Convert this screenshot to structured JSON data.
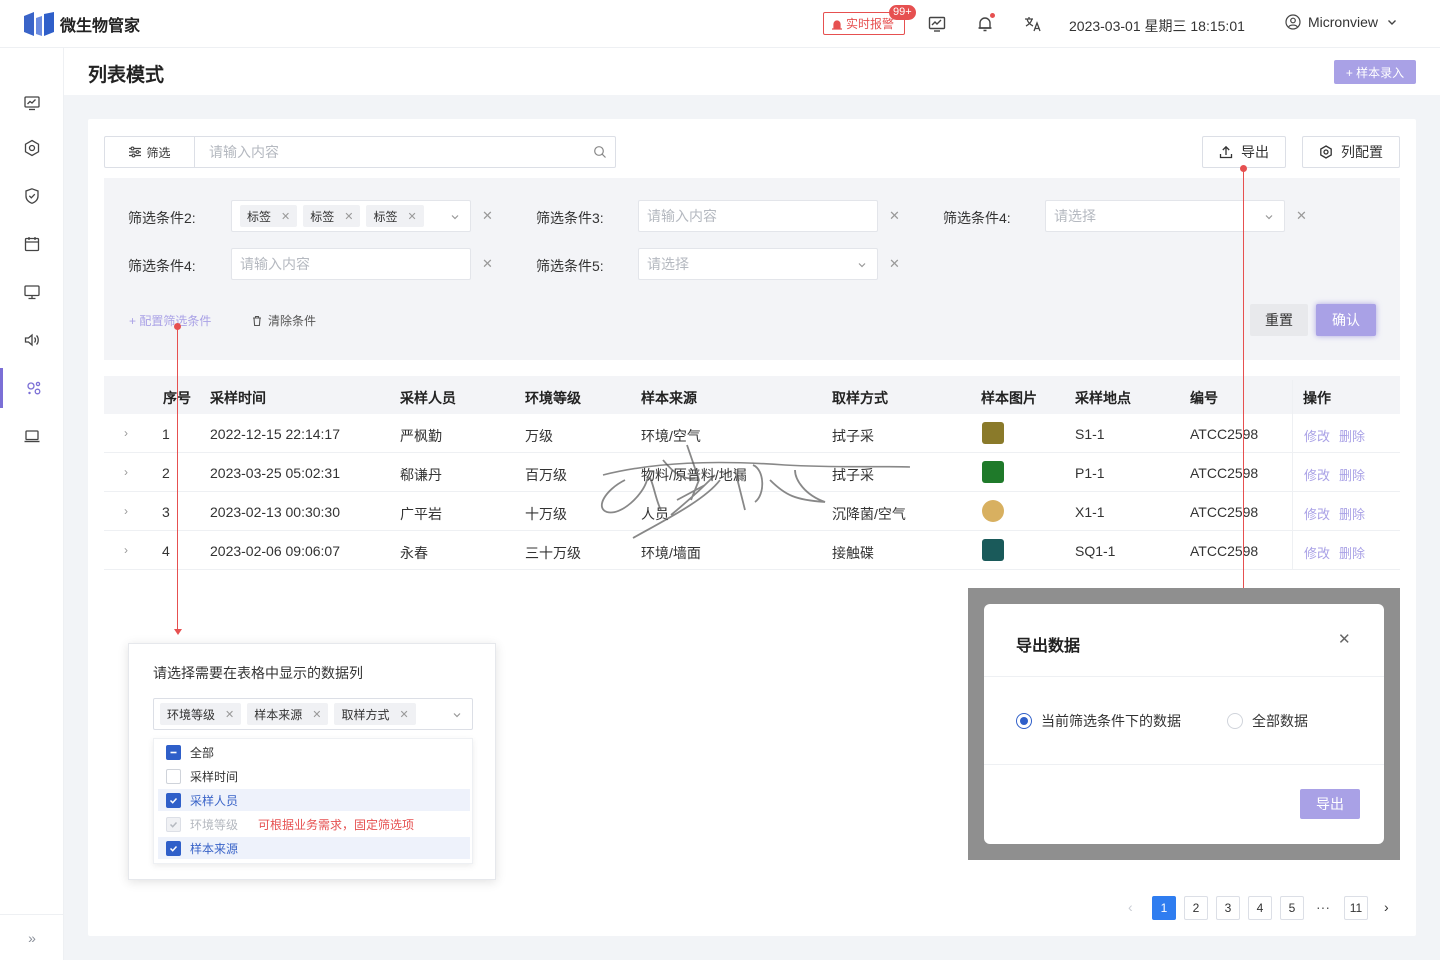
{
  "app": {
    "name": "微生物管家"
  },
  "topbar": {
    "alarm_label": "实时报警",
    "alarm_badge": "99+",
    "datetime": "2023-03-01  星期三  18:15:01",
    "user_name": "Micronview"
  },
  "sidebar": {
    "items": [
      {
        "icon": "monitor-chart-icon"
      },
      {
        "icon": "hexagon-settings-icon"
      },
      {
        "icon": "shield-check-icon"
      },
      {
        "icon": "calendar-icon"
      },
      {
        "icon": "desktop-icon"
      },
      {
        "icon": "speaker-icon"
      },
      {
        "icon": "microbe-icon",
        "active": true
      },
      {
        "icon": "laptop-icon"
      }
    ],
    "expand_label": "»"
  },
  "page": {
    "title": "列表模式",
    "add_sample_label": "+ 样本录入"
  },
  "toolbar": {
    "filter_label": "筛选",
    "search_placeholder": "请输入内容",
    "export_label": "导出",
    "column_config_label": "列配置"
  },
  "filters": {
    "cond2_label": "筛选条件2:",
    "cond2_tags": [
      "标签",
      "标签",
      "标签"
    ],
    "cond3_label": "筛选条件3:",
    "cond3_placeholder": "请输入内容",
    "cond4a_label": "筛选条件4:",
    "cond4a_placeholder": "请选择",
    "cond4b_label": "筛选条件4:",
    "cond4b_placeholder": "请输入内容",
    "cond5_label": "筛选条件5:",
    "cond5_placeholder": "请选择",
    "config_link": "+ 配置筛选条件",
    "clear_link": "清除条件",
    "reset_label": "重置",
    "confirm_label": "确认"
  },
  "table": {
    "columns": [
      "序号",
      "采样时间",
      "采样人员",
      "环境等级",
      "样本来源",
      "取样方式",
      "样本图片",
      "采样地点",
      "编号",
      "操作"
    ],
    "rows": [
      {
        "no": "1",
        "time": "2022-12-15 22:14:17",
        "person": "严枫勤",
        "level": "万级",
        "source": "环境/空气",
        "method": "拭子采",
        "thumb_color": "#8a7a2a",
        "location": "S1-1",
        "code": "ATCC2598"
      },
      {
        "no": "2",
        "time": "2023-03-25 05:02:31",
        "person": "郗谦丹",
        "level": "百万级",
        "source": "物料/原普料/地漏",
        "method": "拭子采",
        "thumb_color": "#1f7a2a",
        "location": "P1-1",
        "code": "ATCC2598"
      },
      {
        "no": "3",
        "time": "2023-02-13 00:30:30",
        "person": "广平岩",
        "level": "十万级",
        "source": "人员",
        "method": "沉降菌/空气",
        "thumb_color": "#d8b060",
        "location": "X1-1",
        "code": "ATCC2598"
      },
      {
        "no": "4",
        "time": "2023-02-06 09:06:07",
        "person": "永春",
        "level": "三十万级",
        "source": "环境/墙面",
        "method": "接触碟",
        "thumb_color": "#1a5a5a",
        "location": "SQ1-1",
        "code": "ATCC2598"
      }
    ],
    "edit_label": "修改",
    "delete_label": "删除"
  },
  "column_popover": {
    "title": "请选择需要在表格中显示的数据列",
    "selected_tags": [
      "环境等级",
      "样本来源",
      "取样方式"
    ],
    "options": [
      {
        "label": "全部",
        "state": "checked"
      },
      {
        "label": "采样时间",
        "state": "unchecked"
      },
      {
        "label": "采样人员",
        "state": "checked"
      },
      {
        "label": "环境等级",
        "state": "disabled"
      },
      {
        "label": "样本来源",
        "state": "checked"
      }
    ],
    "fixed_note": "可根据业务需求，固定筛选项"
  },
  "export_modal": {
    "title": "导出数据",
    "option_current": "当前筛选条件下的数据",
    "option_all": "全部数据",
    "export_label": "导出"
  },
  "pagination": {
    "pages": [
      "1",
      "2",
      "3",
      "4",
      "5"
    ],
    "ellipsis": "···",
    "last": "11",
    "current": "1"
  },
  "colors": {
    "accent": "#a9a1e6",
    "primary_blue": "#2f5fc9",
    "alert_red": "#e65050"
  }
}
